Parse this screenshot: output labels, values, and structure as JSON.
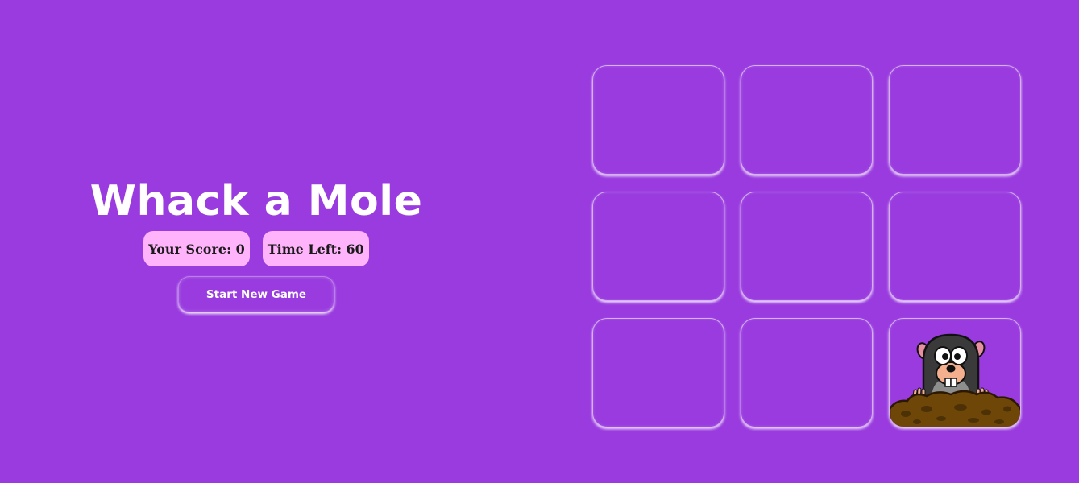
{
  "game": {
    "title": "Whack a Mole",
    "score_text": "Your Score: 0",
    "time_text": "Time Left: 60",
    "start_button_label": "Start New Game"
  },
  "board": {
    "rows": 3,
    "columns": 3,
    "mole_visible_in_hole": 9
  },
  "colors": {
    "background": "#993bdf",
    "stat_pill": "#ffb3fb",
    "title_text": "#ffffff"
  }
}
